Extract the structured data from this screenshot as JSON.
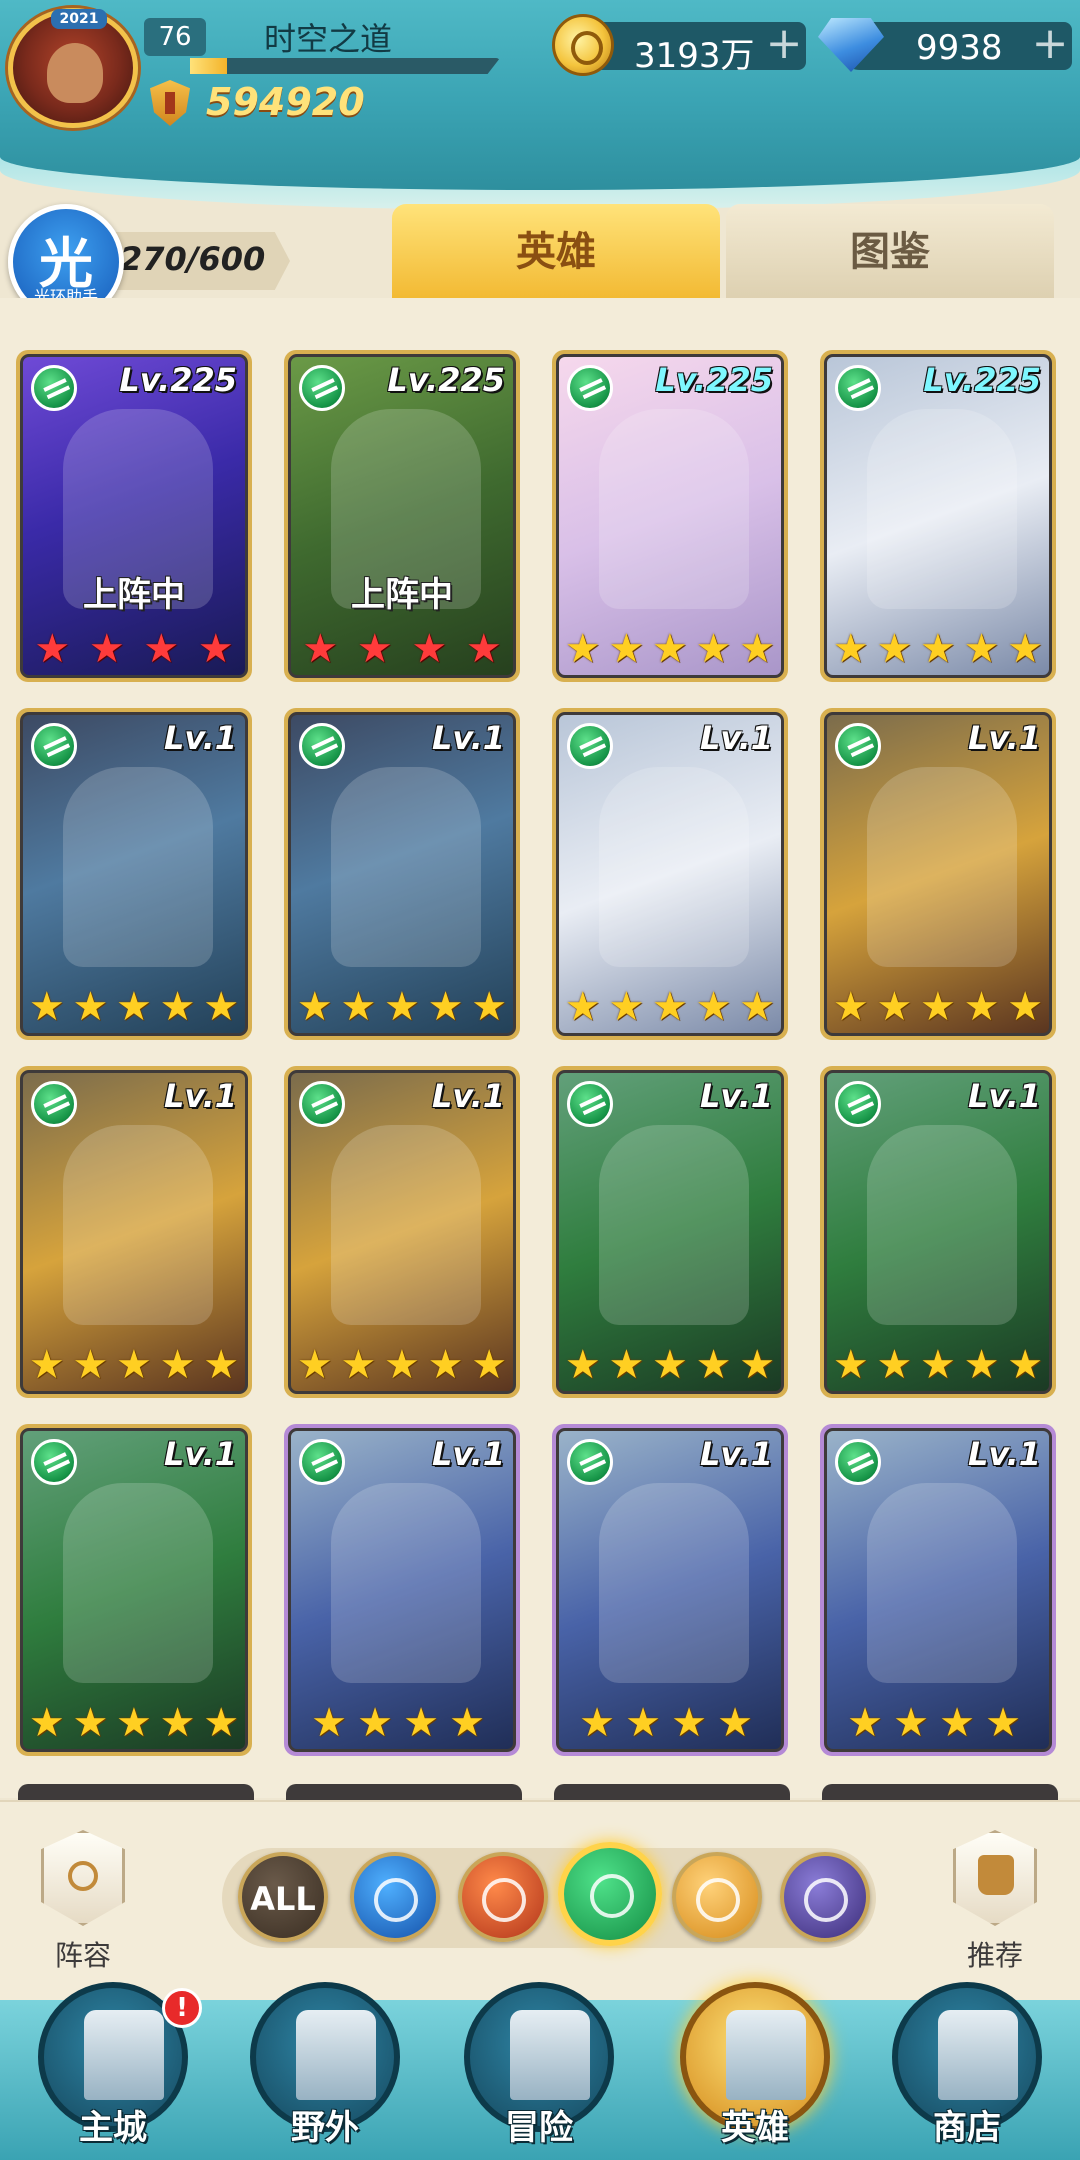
{
  "header": {
    "avatar_year": "2021",
    "level": "76",
    "player_name": "时空之道",
    "xp_progress": 0.12,
    "power": "594920",
    "gold": "3193万",
    "gems": "9938",
    "plus": "+"
  },
  "assistant": {
    "glyph": "光",
    "label": "光环助手"
  },
  "hero_count": "270/600",
  "tabs": [
    {
      "label": "英雄",
      "active": true
    },
    {
      "label": "图鉴",
      "active": false
    }
  ],
  "cards": [
    {
      "level": "Lv.225",
      "deployed": "上阵中",
      "stars": 4,
      "star_color": "red",
      "art": "hooded-purple-assassin"
    },
    {
      "level": "Lv.225",
      "deployed": "上阵中",
      "stars": 4,
      "star_color": "red",
      "art": "blonde-elf-girl"
    },
    {
      "level": "Lv.225",
      "stars": 5,
      "star_color": "gold",
      "art": "blonde-white-robed-woman"
    },
    {
      "level": "Lv.225",
      "stars": 5,
      "star_color": "gold",
      "art": "dark-haired-white-cloak"
    },
    {
      "level": "Lv.1",
      "stars": 5,
      "star_color": "gold",
      "art": "white-haired-warrior"
    },
    {
      "level": "Lv.1",
      "stars": 5,
      "star_color": "gold",
      "art": "white-haired-warrior"
    },
    {
      "level": "Lv.1",
      "stars": 5,
      "star_color": "gold",
      "art": "dark-haired-white-cloak"
    },
    {
      "level": "Lv.1",
      "stars": 5,
      "star_color": "gold",
      "art": "golden-armored-brute"
    },
    {
      "level": "Lv.1",
      "stars": 5,
      "star_color": "gold",
      "art": "golden-armored-brute"
    },
    {
      "level": "Lv.1",
      "stars": 5,
      "star_color": "gold",
      "art": "golden-armored-brute"
    },
    {
      "level": "Lv.1",
      "stars": 5,
      "star_color": "gold",
      "art": "green-horned-druid"
    },
    {
      "level": "Lv.1",
      "stars": 5,
      "star_color": "gold",
      "art": "green-horned-druid"
    },
    {
      "level": "Lv.1",
      "stars": 5,
      "star_color": "gold",
      "art": "green-horned-druid"
    },
    {
      "level": "Lv.1",
      "stars": 4,
      "star_color": "gold",
      "art": "blue-haired-knight"
    },
    {
      "level": "Lv.1",
      "stars": 4,
      "star_color": "gold",
      "art": "blue-haired-knight"
    },
    {
      "level": "Lv.1",
      "stars": 4,
      "star_color": "gold",
      "art": "blue-haired-knight"
    }
  ],
  "filter": {
    "lineup_label": "阵容",
    "recommend_label": "推荐",
    "all_label": "ALL",
    "selected": "wind"
  },
  "nav": [
    {
      "label": "主城",
      "alert": "!"
    },
    {
      "label": "野外"
    },
    {
      "label": "冒险"
    },
    {
      "label": "英雄",
      "active": true
    },
    {
      "label": "商店"
    }
  ]
}
